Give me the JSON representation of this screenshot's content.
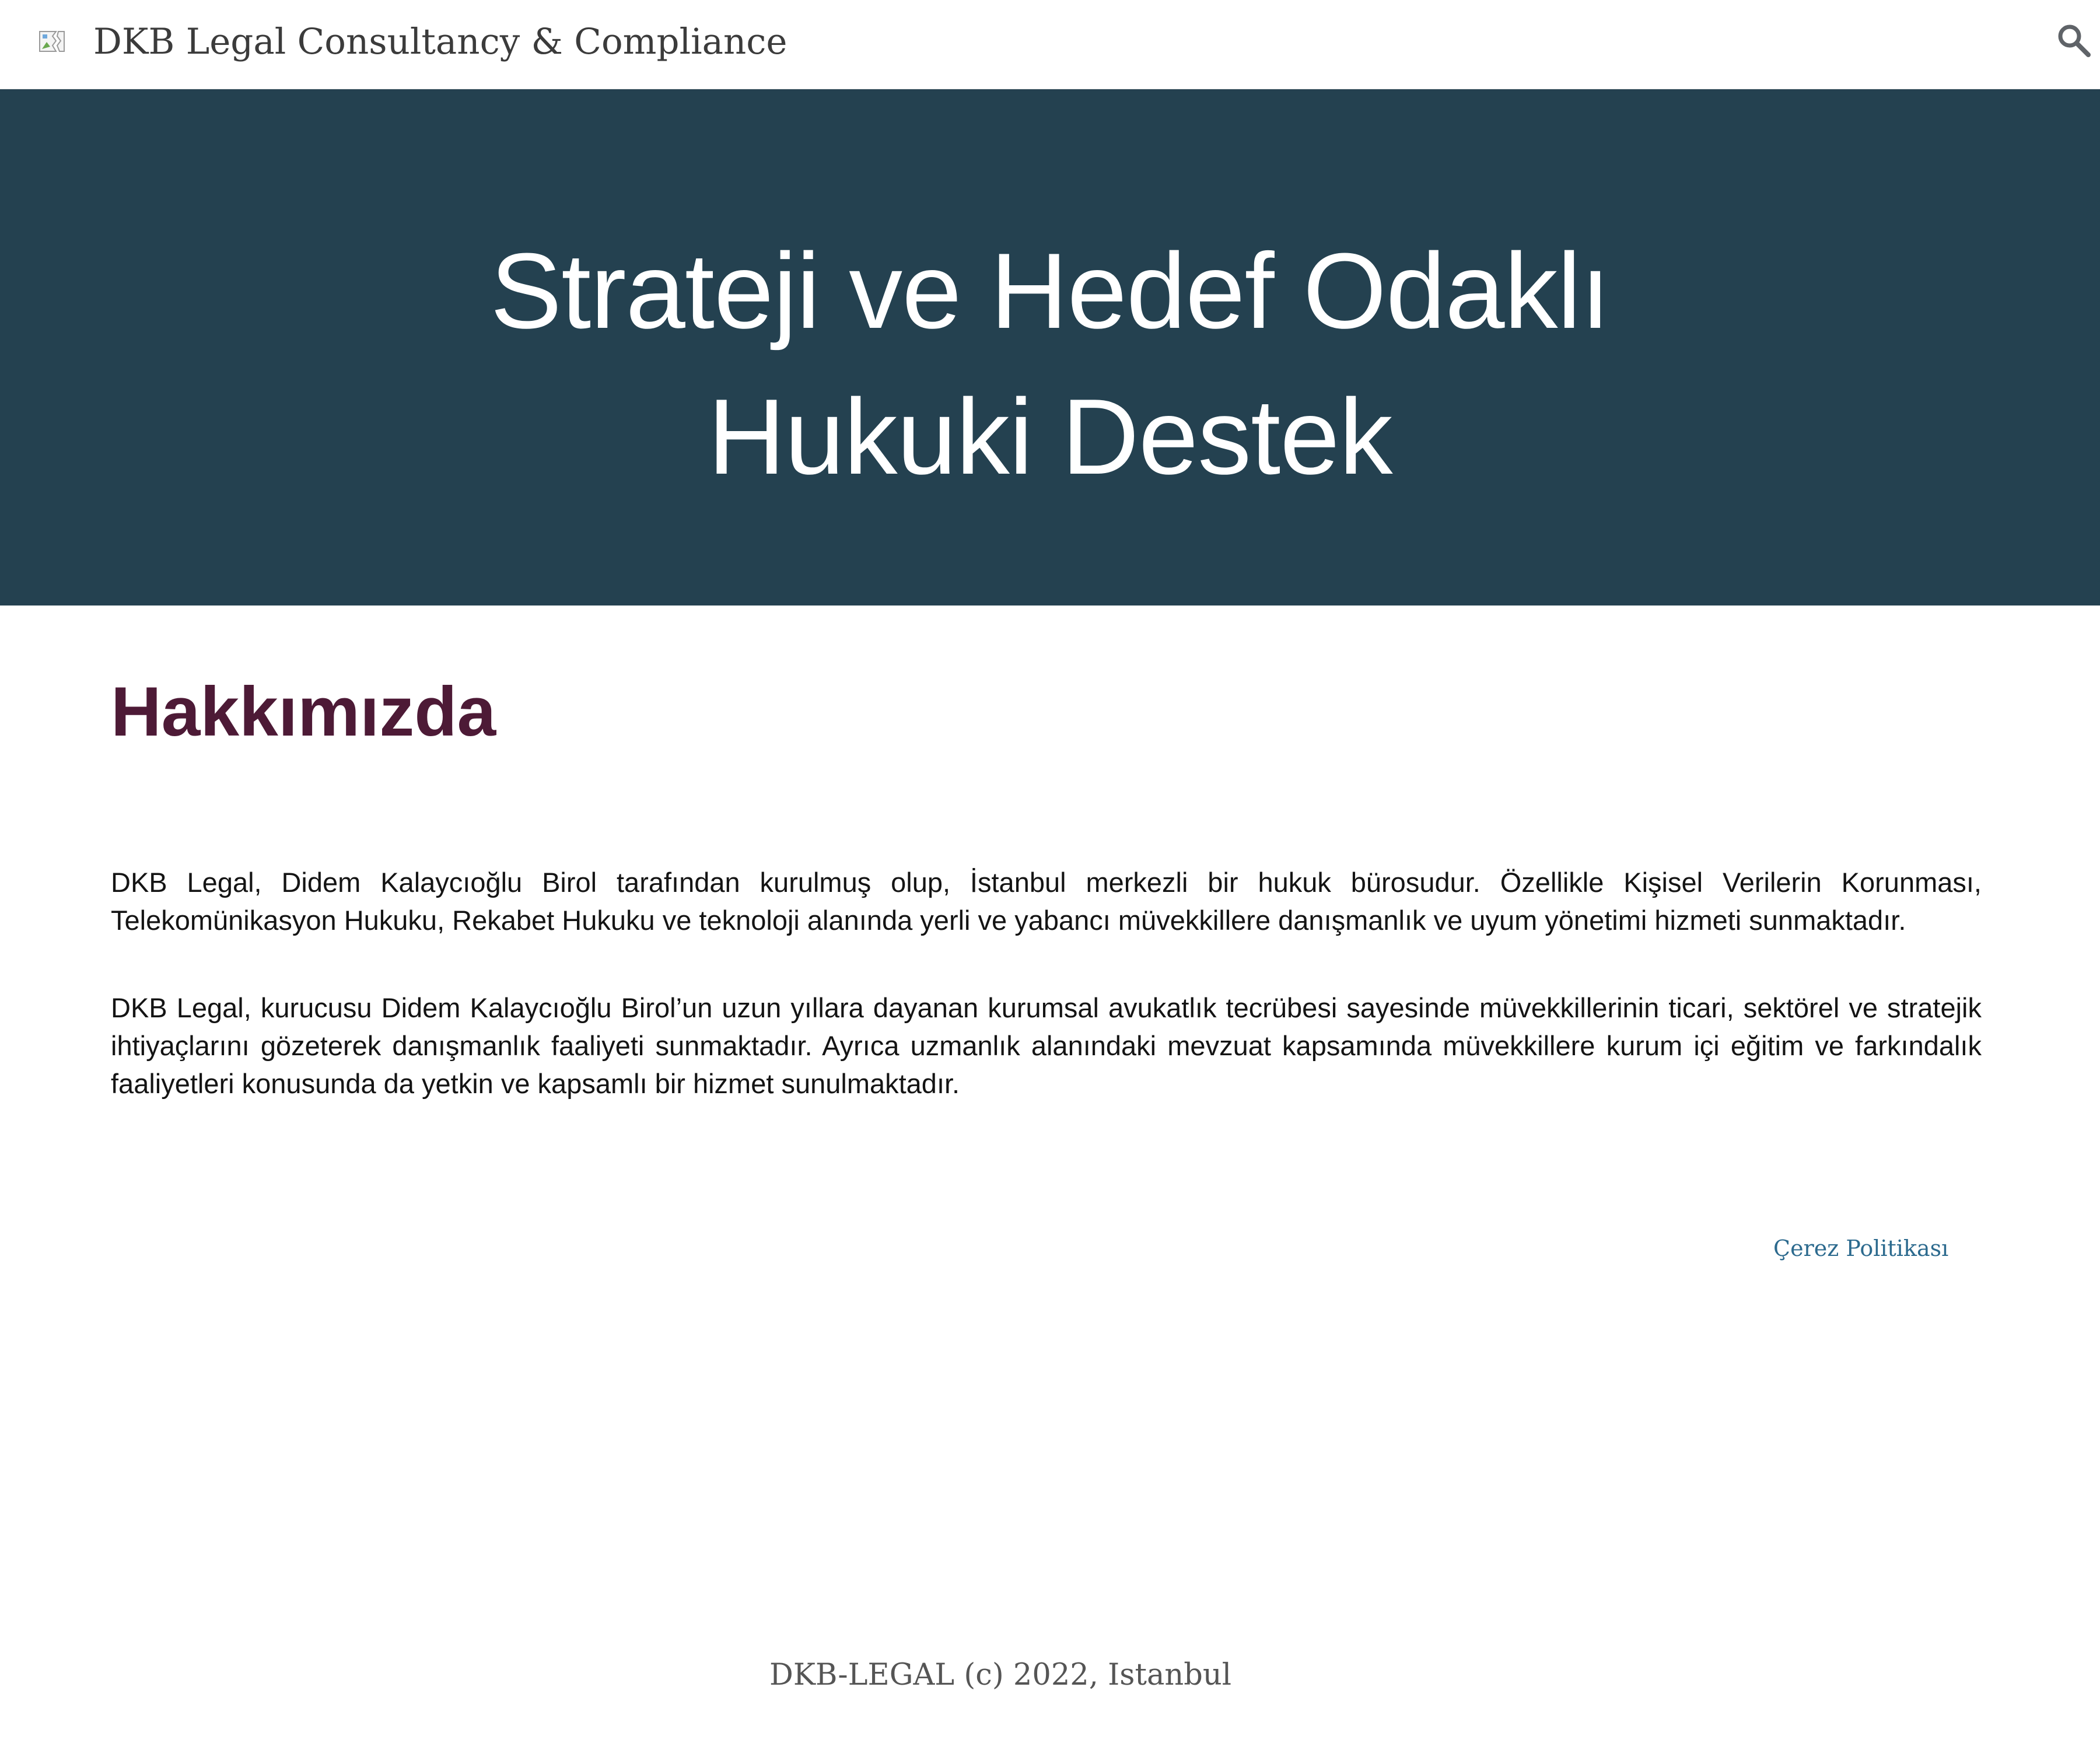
{
  "header": {
    "logo_icon": "broken-image-icon",
    "site_title": "DKB Legal Consultancy & Compliance",
    "search_icon": "search-icon"
  },
  "hero": {
    "title_line1": "Strateji ve Hedef Odaklı",
    "title_line2": "Hukuki Destek",
    "background_color": "#244150"
  },
  "about": {
    "heading": "Hakkımızda",
    "heading_color": "#4d1a36",
    "paragraphs": [
      "DKB Legal, Didem Kalaycıoğlu Birol tarafından kurulmuş olup, İstanbul merkezli bir hukuk bürosudur. Özellikle Kişisel Verilerin Korunması, Telekomünikasyon Hukuku, Rekabet Hukuku ve teknoloji alanında yerli ve yabancı müvekkillere danışmanlık ve uyum yönetimi hizmeti sunmaktadır.",
      "DKB Legal, kurucusu Didem Kalaycıoğlu Birol’un uzun yıllara dayanan kurumsal avukatlık tecrübesi sayesinde müvekkillerinin ticari, sektörel ve stratejik ihtiyaçlarını gözeterek danışmanlık faaliyeti sunmaktadır. Ayrıca uzmanlık alanındaki mevzuat kapsamında müvekkillere kurum içi eğitim ve farkındalık faaliyetleri konusunda da yetkin ve kapsamlı bir hizmet sunulmaktadır."
    ]
  },
  "links": {
    "cookie_policy": "Çerez Politikası",
    "link_color": "#2c6a8e"
  },
  "footer": {
    "text": "DKB-LEGAL (c) 2022, Istanbul"
  }
}
